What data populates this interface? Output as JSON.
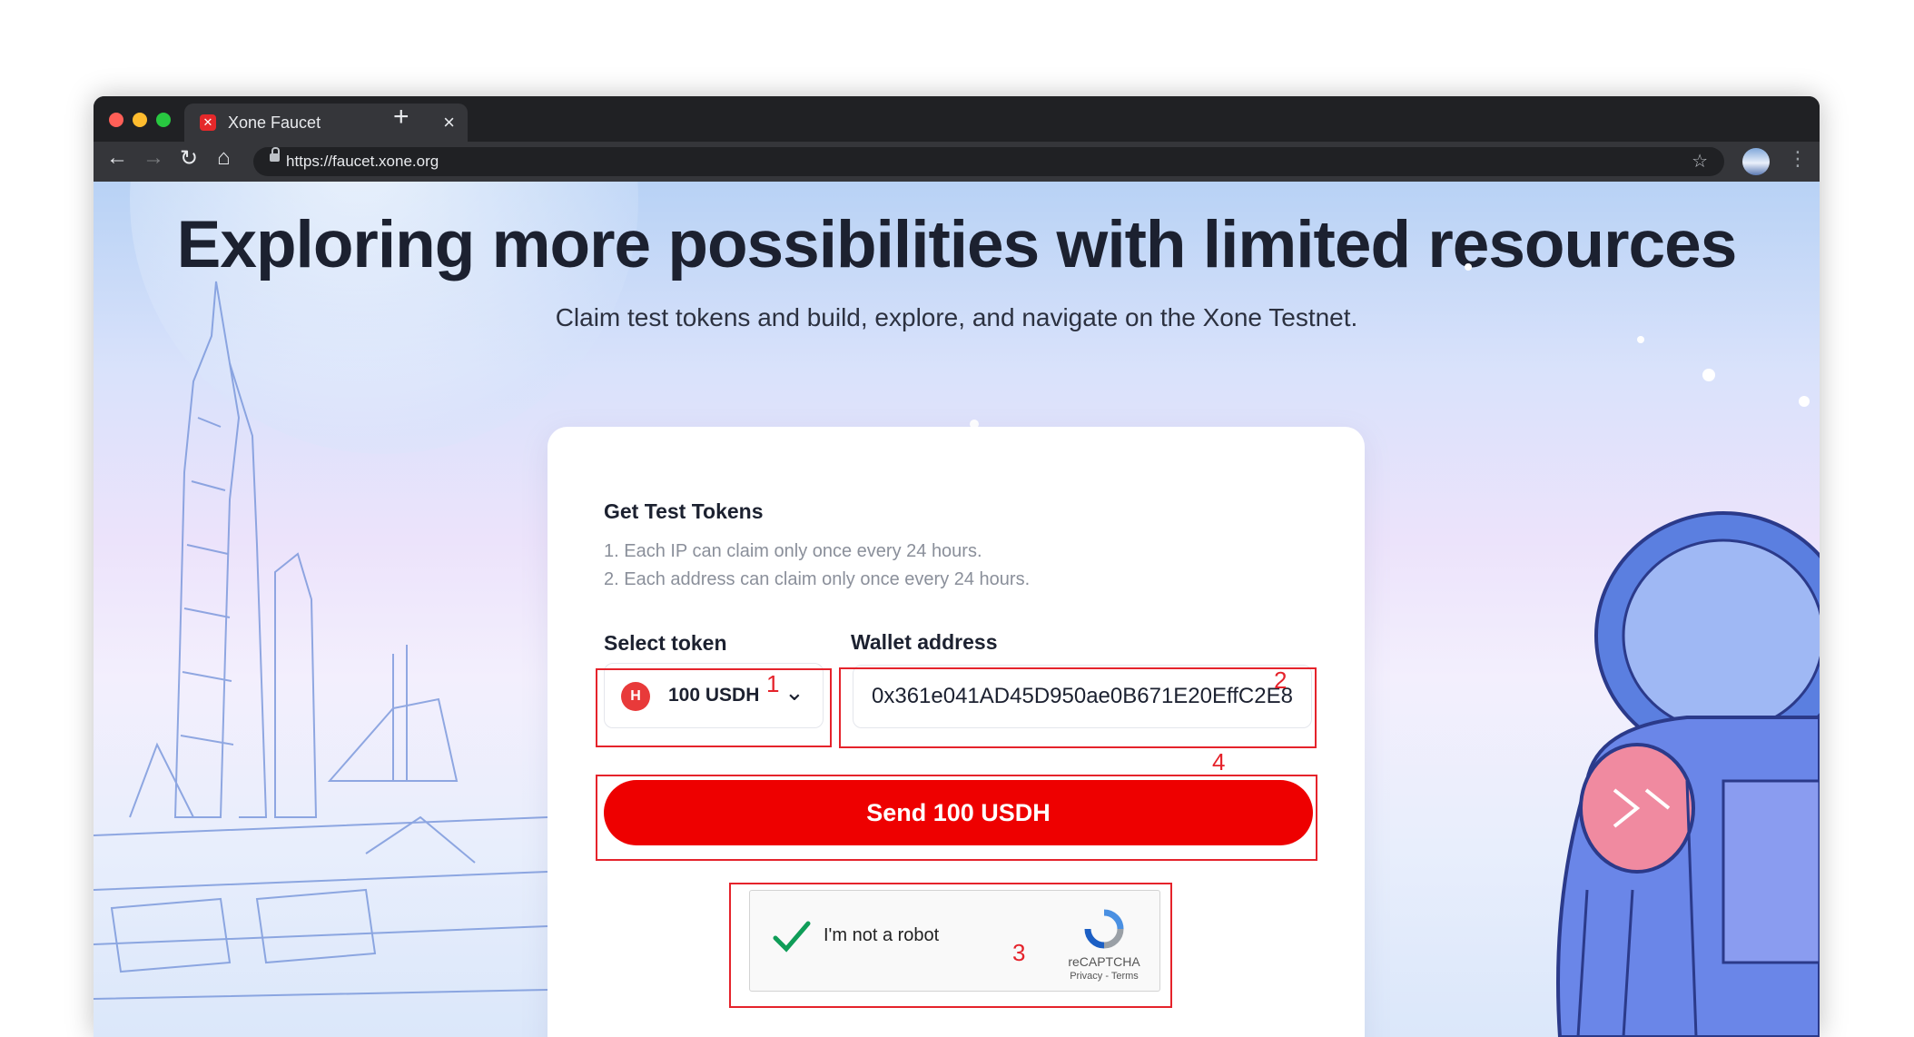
{
  "browser": {
    "tab_title": "Xone Faucet",
    "tab_close": "×",
    "new_tab": "+",
    "url": "https://faucet.xone.org",
    "nav_back": "←",
    "nav_forward": "→",
    "nav_reload": "↻",
    "nav_home": "⌂",
    "bookmark_star": "☆",
    "menu": "⋮"
  },
  "hero": {
    "title": "Exploring more possibilities with limited resources",
    "subtitle": "Claim test tokens and build, explore, and navigate on the Xone Testnet."
  },
  "card": {
    "title": "Get Test Tokens",
    "rules": [
      "1. Each IP can claim only once every 24 hours.",
      "2. Each address can claim only once every 24 hours."
    ],
    "select_label": "Select token",
    "selected_token": "100 USDH",
    "wallet_label": "Wallet address",
    "wallet_value": "0x361e041AD45D950ae0B671E20EffC2E8",
    "send_button": "Send 100 USDH"
  },
  "captcha": {
    "label": "I'm not a robot",
    "brand": "reCAPTCHA",
    "links": "Privacy - Terms",
    "checked": true
  },
  "annotations": [
    "1",
    "2",
    "3",
    "4"
  ],
  "colors": {
    "accent": "#ee0000",
    "annotation": "#e5232b",
    "browser_chrome": "#202124"
  }
}
